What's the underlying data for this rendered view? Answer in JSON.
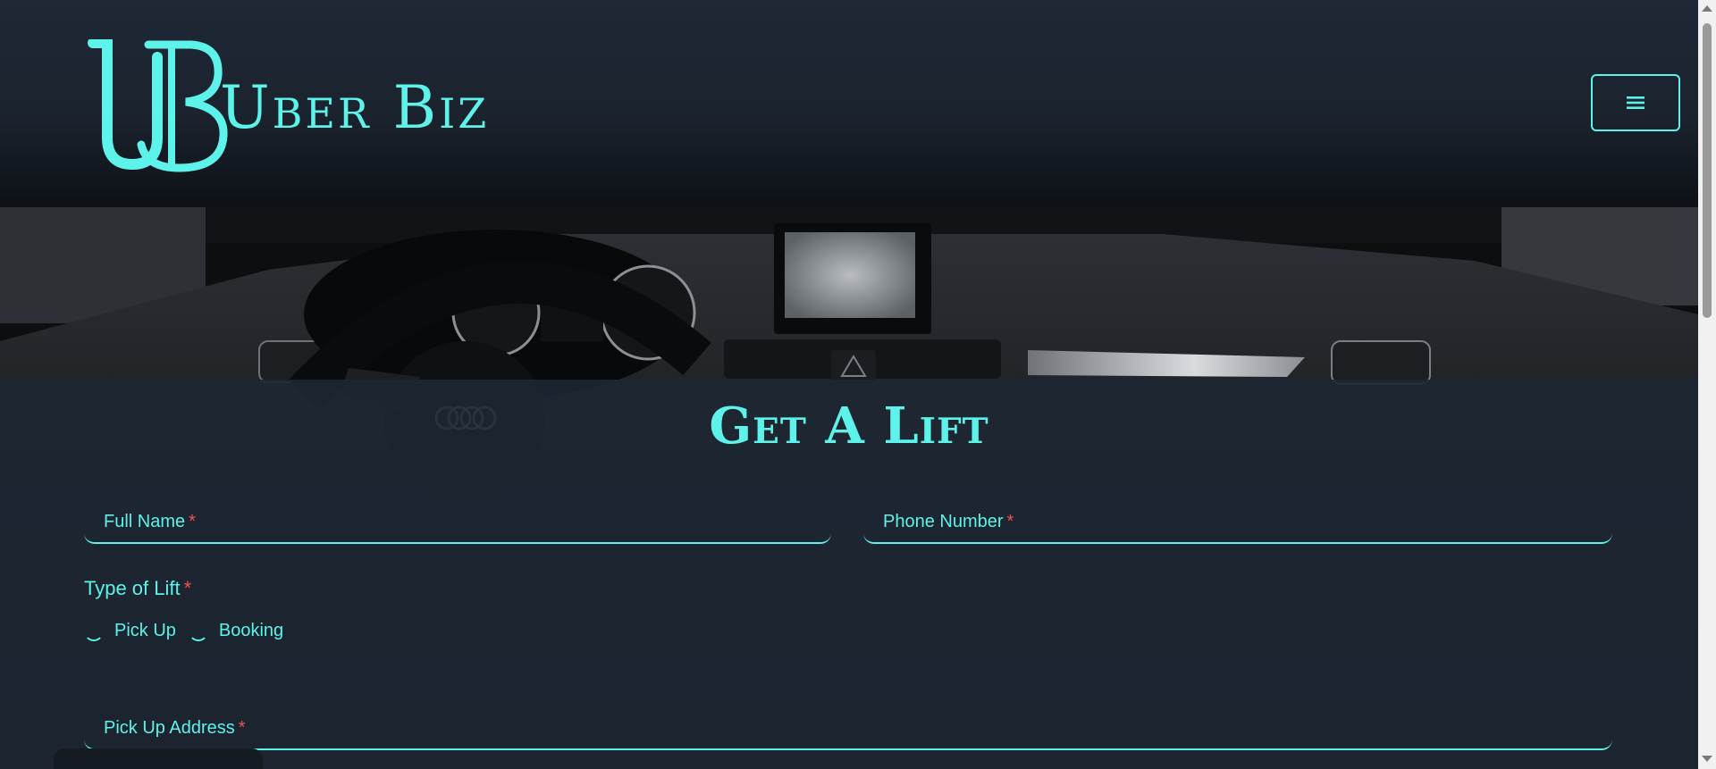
{
  "header": {
    "logo_text": "Uber Biz",
    "logo_icon": "ub-monogram-icon",
    "menu_icon": "hamburger-menu-icon"
  },
  "hero": {
    "image": "car-dashboard-image"
  },
  "form": {
    "title": "Get A Lift",
    "full_name_label": "Full Name",
    "phone_label": "Phone Number",
    "lift_type_label": "Type of Lift",
    "lift_options": [
      "Pick Up",
      "Booking"
    ],
    "pickup_address_label": "Pick Up Address",
    "required_mark": "*"
  },
  "colors": {
    "accent": "#5ef3ea",
    "background": "#1d2733",
    "required": "#ef5350"
  }
}
